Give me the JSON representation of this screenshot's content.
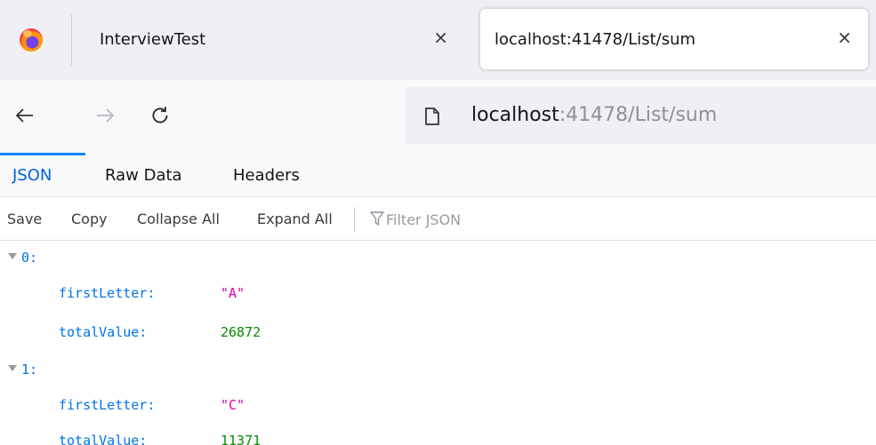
{
  "browser": {
    "tabs": [
      {
        "title": "InterviewTest",
        "active": false
      },
      {
        "title": "localhost:41478/List/sum",
        "active": true
      }
    ],
    "close_glyph": "×",
    "url": {
      "host": "localhost",
      "path": ":41478/List/sum"
    },
    "icons": [
      "firefox-logo",
      "back-arrow-icon",
      "forward-arrow-icon",
      "reload-icon",
      "page-icon",
      "close-icon"
    ]
  },
  "viewer": {
    "tabs": [
      {
        "label": "JSON",
        "active": true
      },
      {
        "label": "Raw Data",
        "active": false
      },
      {
        "label": "Headers",
        "active": false
      }
    ],
    "toolbar": {
      "save": "Save",
      "copy": "Copy",
      "collapse_all": "Collapse All",
      "expand_all": "Expand All",
      "filter_placeholder": "Filter JSON"
    }
  },
  "json_tree": [
    {
      "index_label": "0:",
      "fields": [
        {
          "key": "firstLetter:",
          "value": "\"A\"",
          "type": "string"
        },
        {
          "key": "totalValue:",
          "value": "26872",
          "type": "number"
        }
      ]
    },
    {
      "index_label": "1:",
      "fields": [
        {
          "key": "firstLetter:",
          "value": "\"C\"",
          "type": "string"
        },
        {
          "key": "totalValue:",
          "value": "11371",
          "type": "number"
        }
      ]
    }
  ],
  "colors": {
    "accent": "#0060df",
    "key": "#0074e8",
    "string": "#dd00a9",
    "number": "#058b00"
  }
}
